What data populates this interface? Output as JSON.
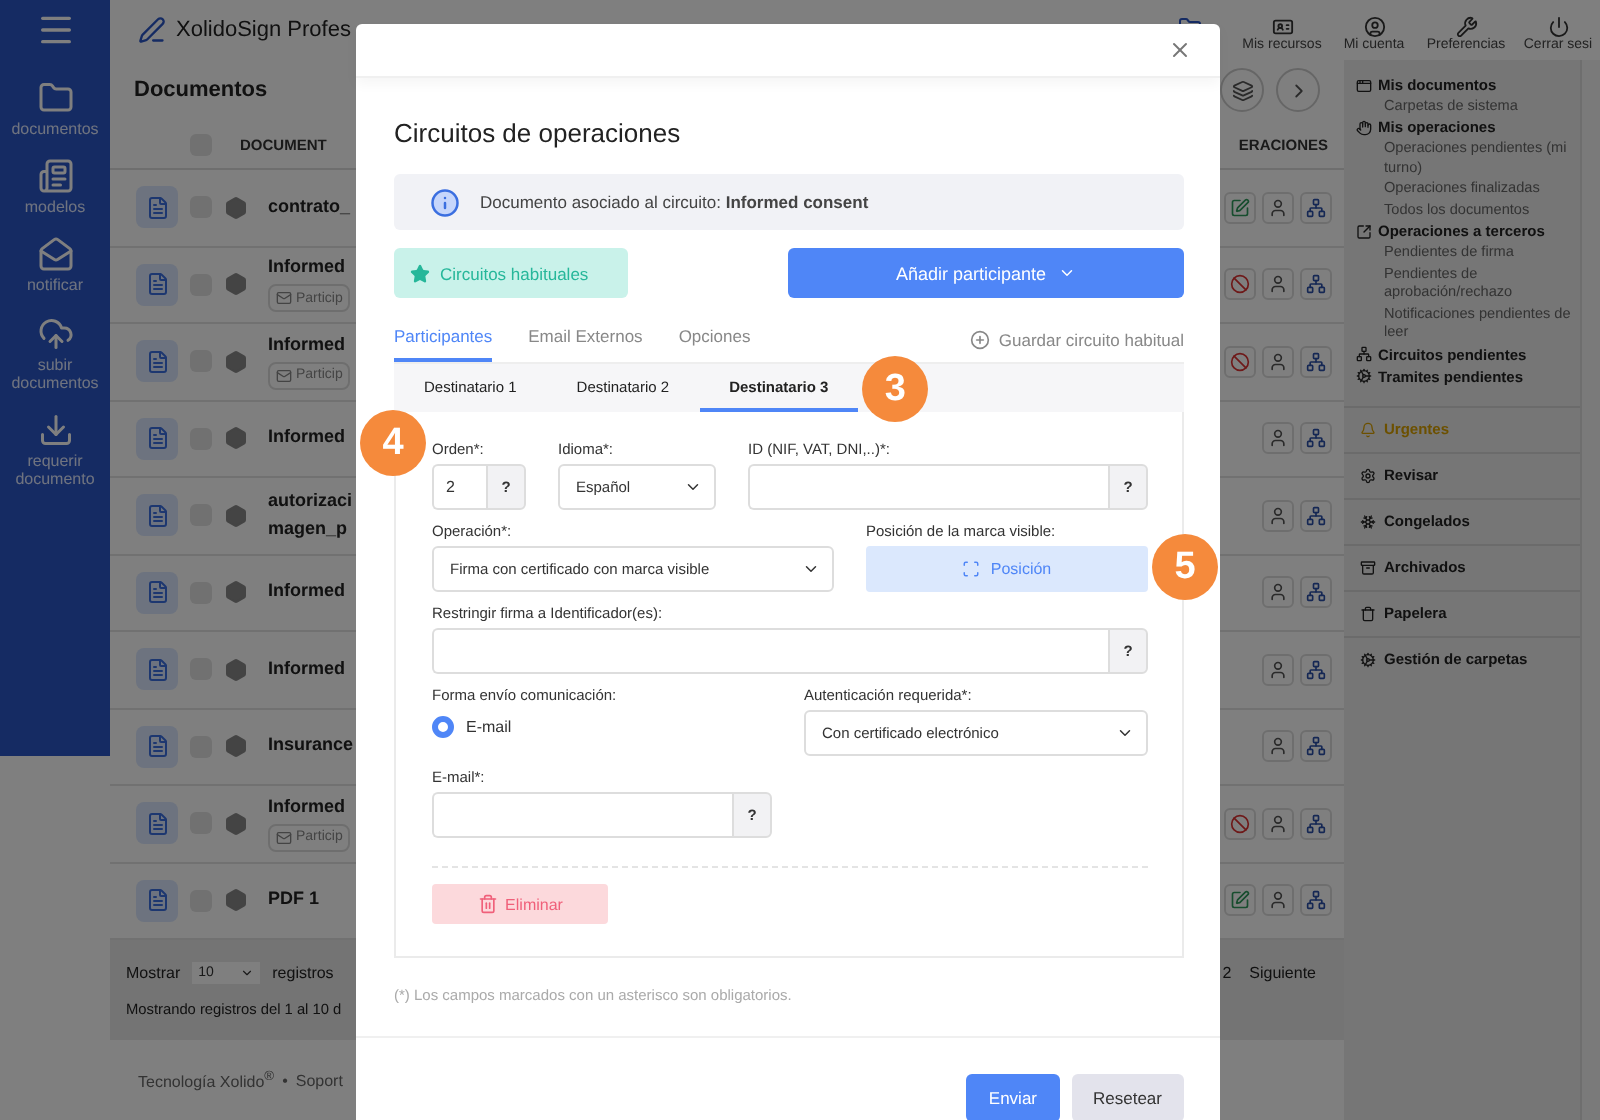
{
  "app": {
    "title": "XolidoSign Profes",
    "top_actions": [
      {
        "label": "Mis recursos"
      },
      {
        "label": "Mi cuenta"
      },
      {
        "label": "Preferencias"
      },
      {
        "label": "Cerrar sesi"
      }
    ]
  },
  "sidebar": {
    "items": [
      {
        "label": "documentos"
      },
      {
        "label": "modelos"
      },
      {
        "label": "notificar"
      },
      {
        "label": "subir documentos"
      },
      {
        "label": "requerir documento"
      }
    ]
  },
  "documents": {
    "title": "Documentos",
    "select_all_checked": false,
    "columns": [
      "DOCUMENT",
      "ERACIONES"
    ],
    "rows": [
      {
        "lines": [
          "contrato_"
        ],
        "checked": false,
        "tag": "",
        "actions": [
          {
            "kind": "edit"
          },
          {
            "kind": "user"
          },
          {
            "kind": "network"
          }
        ]
      },
      {
        "lines": [
          "Informed"
        ],
        "checked": false,
        "tag": "Particip",
        "actions": [
          {
            "kind": "ban"
          },
          {
            "kind": "user"
          },
          {
            "kind": "network"
          }
        ]
      },
      {
        "lines": [
          "Informed"
        ],
        "checked": false,
        "tag": "Particip",
        "actions": [
          {
            "kind": "ban"
          },
          {
            "kind": "user"
          },
          {
            "kind": "network"
          }
        ]
      },
      {
        "lines": [
          "Informed"
        ],
        "checked": false,
        "tag": "",
        "actions": [
          {
            "kind": "user"
          },
          {
            "kind": "network"
          }
        ]
      },
      {
        "lines": [
          "autorizaci",
          "magen_p"
        ],
        "checked": false,
        "tag": "",
        "actions": [
          {
            "kind": "user"
          },
          {
            "kind": "network"
          }
        ]
      },
      {
        "lines": [
          "Informed"
        ],
        "checked": false,
        "tag": "",
        "actions": [
          {
            "kind": "user"
          },
          {
            "kind": "network"
          }
        ]
      },
      {
        "lines": [
          "Informed"
        ],
        "checked": false,
        "tag": "",
        "actions": [
          {
            "kind": "user"
          },
          {
            "kind": "network"
          }
        ]
      },
      {
        "lines": [
          "Insurance"
        ],
        "checked": false,
        "tag": "",
        "actions": [
          {
            "kind": "user"
          },
          {
            "kind": "network"
          }
        ]
      },
      {
        "lines": [
          "Informed"
        ],
        "checked": false,
        "tag": "Particip",
        "actions": [
          {
            "kind": "ban"
          },
          {
            "kind": "user"
          },
          {
            "kind": "network"
          }
        ]
      },
      {
        "lines": [
          "PDF 1"
        ],
        "checked": false,
        "tag": "",
        "actions": [
          {
            "kind": "edit"
          },
          {
            "kind": "user"
          },
          {
            "kind": "network"
          }
        ]
      }
    ],
    "pager": {
      "show_label": "Mostrar",
      "page_size": "10",
      "records_label": "registros",
      "page": "2",
      "next": "Siguiente",
      "summary": "Mostrando registros del 1 al 10 d"
    }
  },
  "footer": {
    "brand": "Tecnología Xolido$^{®}$",
    "separator": "•",
    "support": "Soport"
  },
  "right_nav": {
    "groups": [
      {
        "label": "Mis documentos",
        "children": [
          {
            "label": "Carpetas de sistema"
          }
        ]
      },
      {
        "label": "Mis operaciones",
        "children": [
          {
            "label": "Operaciones pendientes (mi turno)"
          },
          {
            "label": "Operaciones finalizadas"
          },
          {
            "label": "Todos los documentos"
          }
        ]
      },
      {
        "label": "Operaciones a terceros",
        "children": [
          {
            "label": "Pendientes de firma"
          },
          {
            "label": "Pendientes de aprobación/rechazo"
          },
          {
            "label": "Notificaciones pendientes de leer"
          }
        ]
      },
      {
        "label": "Circuitos pendientes"
      },
      {
        "label": "Tramites pendientes"
      }
    ],
    "sections": [
      {
        "label": "Urgentes",
        "kind": "alert"
      },
      {
        "label": "Revisar",
        "kind": "normal"
      },
      {
        "label": "Congelados",
        "kind": "normal"
      },
      {
        "label": "Archivados",
        "kind": "normal"
      },
      {
        "label": "Papelera",
        "kind": "normal"
      },
      {
        "label": "Gestión de carpetas",
        "kind": "normal"
      }
    ]
  },
  "modal": {
    "title": "Circuitos de operaciones",
    "info": "Documento asociado al circuito: **Informed consent**",
    "habitual_button": "Circuitos habituales",
    "add_button": "Añadir participante",
    "tabs": [
      {
        "label": "Participantes",
        "selected": true
      },
      {
        "label": "Email Externos",
        "selected": false
      },
      {
        "label": "Opciones",
        "selected": false
      }
    ],
    "save_link": "Guardar circuito habitual",
    "recipients": [
      {
        "label": "Destinatario 1",
        "selected": false
      },
      {
        "label": "Destinatario 2",
        "selected": false
      },
      {
        "label": "Destinatario 3",
        "selected": true,
        "callout": "3"
      }
    ],
    "form": {
      "order": {
        "label": "Orden*:",
        "value": "2",
        "help": "?",
        "callout": "4"
      },
      "language": {
        "label": "Idioma*:",
        "value": "Español"
      },
      "id": {
        "label": "ID (NIF, VAT, DNI,..)*:",
        "help": "?"
      },
      "operation": {
        "label": "Operación*:",
        "value": "Firma con certificado con marca visible"
      },
      "position": {
        "label": "Posición de la marca visible:",
        "button": "Posición",
        "callout": "5"
      },
      "restrict": {
        "label": "Restringir firma a Identificador(es):",
        "help": "?"
      },
      "delivery": {
        "label": "Forma envío comunicación:",
        "options": [
          {
            "label": "E-mail",
            "selected": true
          }
        ]
      },
      "auth": {
        "label": "Autenticación requerida*:",
        "value": "Con certificado electrónico"
      },
      "email": {
        "label": "E-mail*:",
        "help": "?"
      },
      "delete_button": "Eliminar"
    },
    "note": "(*) Los campos marcados con un asterisco son obligatorios.",
    "buttons": [
      {
        "label": "Enviar",
        "kind": "primary"
      },
      {
        "label": "Resetear",
        "kind": "secondary"
      }
    ]
  }
}
